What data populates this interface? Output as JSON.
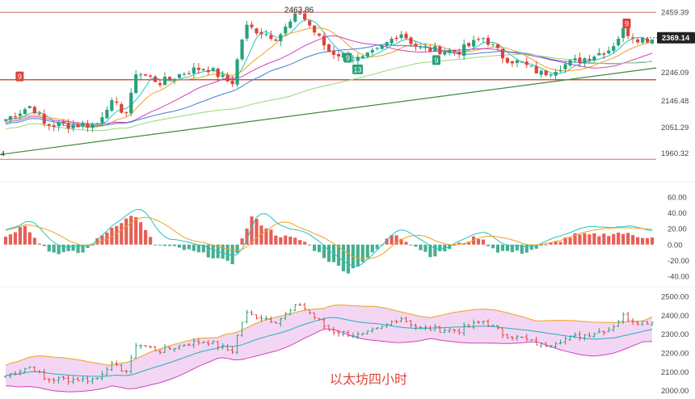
{
  "chart_data": [
    {
      "type": "candlestick",
      "panel": "price",
      "title": "",
      "y_ticks": [
        2459.39,
        2246.09,
        2146.48,
        2051.29,
        1960.32
      ],
      "ylim": [
        1890,
        2480
      ],
      "current_price": "2369.14",
      "peak_label": "2463.86",
      "peak_value": 2463.86,
      "horizontal_levels": [
        2459.39,
        2220,
        1938
      ],
      "trendline": {
        "start_value": 1955,
        "end_value": 2262
      },
      "markers": [
        {
          "text": "9",
          "color": "#e0433a",
          "x_frac": 0.03,
          "value": 2232
        },
        {
          "text": "9",
          "color": "#26a17b",
          "x_frac": 0.53,
          "value": 2298
        },
        {
          "text": "13",
          "color": "#26a17b",
          "x_frac": 0.545,
          "value": 2257
        },
        {
          "text": "9",
          "color": "#26a17b",
          "x_frac": 0.665,
          "value": 2290
        },
        {
          "text": "9",
          "color": "#e0433a",
          "x_frac": 0.955,
          "value": 2420
        }
      ],
      "left_edge_label": "4",
      "colors": {
        "up": "#26a17b",
        "down": "#e0433a",
        "level": "#d96a6a",
        "trend": "#3f8a3a"
      }
    },
    {
      "type": "bar",
      "panel": "macd",
      "y_ticks": [
        "60.00",
        "40.00",
        "20.00",
        "0.00",
        "-20.00",
        "-40.00"
      ],
      "ylim": [
        -48,
        68
      ]
    },
    {
      "type": "area",
      "panel": "bollinger",
      "y_ticks": [
        "2500.00",
        "2400.00",
        "2300.00",
        "2200.00",
        "2100.00",
        "2000.00"
      ],
      "ylim": [
        1990,
        2530
      ]
    }
  ],
  "price_anchors": [
    [
      0,
      2080
    ],
    [
      0.04,
      2130
    ],
    [
      0.06,
      2060
    ],
    [
      0.1,
      2060
    ],
    [
      0.14,
      2060
    ],
    [
      0.16,
      2140
    ],
    [
      0.19,
      2100
    ],
    [
      0.2,
      2250
    ],
    [
      0.24,
      2210
    ],
    [
      0.28,
      2250
    ],
    [
      0.31,
      2265
    ],
    [
      0.35,
      2205
    ],
    [
      0.37,
      2410
    ],
    [
      0.42,
      2370
    ],
    [
      0.455,
      2460
    ],
    [
      0.5,
      2320
    ],
    [
      0.55,
      2290
    ],
    [
      0.58,
      2330
    ],
    [
      0.61,
      2390
    ],
    [
      0.64,
      2330
    ],
    [
      0.7,
      2320
    ],
    [
      0.74,
      2370
    ],
    [
      0.77,
      2300
    ],
    [
      0.8,
      2275
    ],
    [
      0.83,
      2240
    ],
    [
      0.86,
      2270
    ],
    [
      0.9,
      2300
    ],
    [
      0.935,
      2330
    ],
    [
      0.955,
      2395
    ],
    [
      0.98,
      2365
    ]
  ],
  "macd_anchors": [
    [
      0,
      10
    ],
    [
      0.03,
      25
    ],
    [
      0.05,
      5
    ],
    [
      0.07,
      -10
    ],
    [
      0.12,
      -10
    ],
    [
      0.15,
      12
    ],
    [
      0.17,
      25
    ],
    [
      0.2,
      38
    ],
    [
      0.23,
      0
    ],
    [
      0.27,
      -5
    ],
    [
      0.32,
      -15
    ],
    [
      0.35,
      -25
    ],
    [
      0.38,
      35
    ],
    [
      0.42,
      12
    ],
    [
      0.46,
      5
    ],
    [
      0.5,
      -20
    ],
    [
      0.53,
      -35
    ],
    [
      0.57,
      -10
    ],
    [
      0.6,
      15
    ],
    [
      0.62,
      5
    ],
    [
      0.66,
      -15
    ],
    [
      0.7,
      0
    ],
    [
      0.73,
      10
    ],
    [
      0.76,
      -8
    ],
    [
      0.8,
      -10
    ],
    [
      0.84,
      0
    ],
    [
      0.88,
      12
    ],
    [
      0.92,
      12
    ],
    [
      0.95,
      15
    ],
    [
      0.98,
      10
    ]
  ],
  "watermark_text": "以太坊四小时",
  "price_axis_values": [
    "2459.39",
    "2246.09",
    "2146.48",
    "2051.29",
    "1960.32"
  ]
}
